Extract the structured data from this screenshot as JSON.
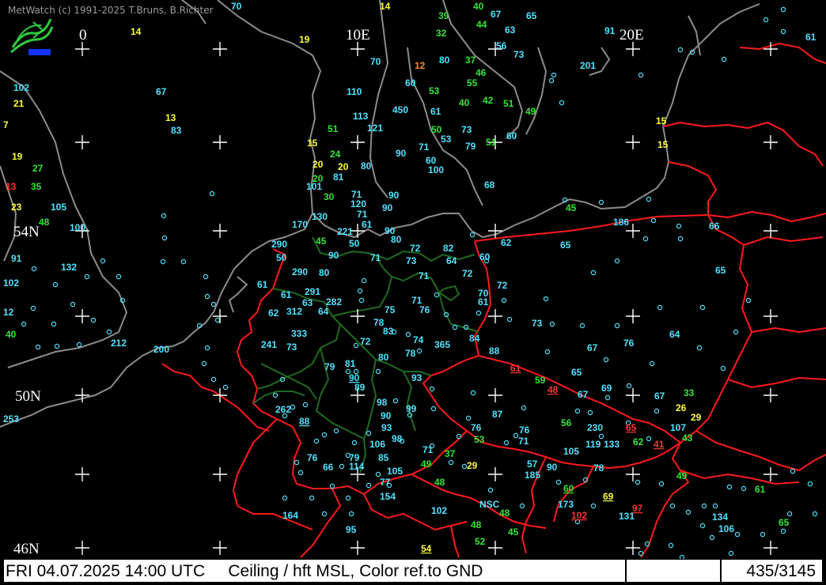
{
  "app": {
    "credit": "MetWatch  (c) 1991-2025 T.Bruns, B.Richter"
  },
  "status": {
    "datetime": "FRI 04.07.2025 14:00 UTC",
    "product": "Ceiling / hft MSL, Color ref.to GND",
    "count": "435/3145"
  },
  "colors": {
    "background": "#000000",
    "coast": "#8c8c8c",
    "border": "#ff1a1a",
    "germany_states": "#1f6a1f",
    "val_cyan": "#4fe3ff",
    "val_green": "#33e633",
    "val_yellow": "#ffff33",
    "val_orange": "#ff8c1a",
    "val_red": "#ff3333",
    "val_white": "#ffffff"
  },
  "grid_labels": {
    "lon_0": "0",
    "lon_10e": "10E",
    "lon_20e": "20E",
    "lat_54n": "54N",
    "lat_50n": "50N",
    "lat_46n": "46N"
  },
  "observations": [
    {
      "v": "70",
      "c": "cyan"
    },
    {
      "v": "14",
      "c": "yellow"
    },
    {
      "v": "39",
      "c": "green"
    },
    {
      "v": "40",
      "c": "green"
    },
    {
      "v": "67",
      "c": "cyan"
    },
    {
      "v": "65",
      "c": "cyan"
    },
    {
      "v": "14",
      "c": "yellow"
    },
    {
      "v": "19",
      "c": "yellow"
    },
    {
      "v": "32",
      "c": "green"
    },
    {
      "v": "44",
      "c": "green"
    },
    {
      "v": "63",
      "c": "cyan"
    },
    {
      "v": "91",
      "c": "cyan"
    },
    {
      "v": "61",
      "c": "cyan"
    },
    {
      "v": "70",
      "c": "cyan"
    },
    {
      "v": "12",
      "c": "orange"
    },
    {
      "v": "80",
      "c": "cyan"
    },
    {
      "v": "37",
      "c": "green"
    },
    {
      "v": "56",
      "c": "cyan"
    },
    {
      "v": "73",
      "c": "cyan"
    },
    {
      "v": "201",
      "c": "cyan"
    },
    {
      "v": "46",
      "c": "green"
    },
    {
      "v": "102",
      "c": "cyan"
    },
    {
      "v": "67",
      "c": "cyan"
    },
    {
      "v": "60",
      "c": "cyan"
    },
    {
      "v": "55",
      "c": "green"
    },
    {
      "v": "110",
      "c": "cyan"
    },
    {
      "v": "53",
      "c": "green"
    },
    {
      "v": "21",
      "c": "yellow"
    },
    {
      "v": "40",
      "c": "green"
    },
    {
      "v": "42",
      "c": "green"
    },
    {
      "v": "51",
      "c": "green"
    },
    {
      "v": "450",
      "c": "cyan"
    },
    {
      "v": "61",
      "c": "cyan"
    },
    {
      "v": "49",
      "c": "green"
    },
    {
      "v": "13",
      "c": "yellow"
    },
    {
      "v": "113",
      "c": "cyan"
    },
    {
      "v": "7",
      "c": "yellow"
    },
    {
      "v": "83",
      "c": "cyan"
    },
    {
      "v": "51",
      "c": "green"
    },
    {
      "v": "121",
      "c": "cyan"
    },
    {
      "v": "50",
      "c": "green"
    },
    {
      "v": "73",
      "c": "cyan"
    },
    {
      "v": "15",
      "c": "yellow"
    },
    {
      "v": "60",
      "c": "cyan"
    },
    {
      "v": "53",
      "c": "cyan"
    },
    {
      "v": "51",
      "c": "green"
    },
    {
      "v": "15",
      "c": "yellow"
    },
    {
      "v": "79",
      "c": "cyan"
    },
    {
      "v": "15",
      "c": "yellow"
    },
    {
      "v": "71",
      "c": "cyan"
    },
    {
      "v": "19",
      "c": "yellow"
    },
    {
      "v": "24",
      "c": "green"
    },
    {
      "v": "90",
      "c": "cyan"
    },
    {
      "v": "60",
      "c": "cyan"
    },
    {
      "v": "20",
      "c": "yellow"
    },
    {
      "v": "20",
      "c": "yellow"
    },
    {
      "v": "80",
      "c": "cyan"
    },
    {
      "v": "100",
      "c": "cyan"
    },
    {
      "v": "27",
      "c": "green"
    },
    {
      "v": "81",
      "c": "cyan"
    },
    {
      "v": "20",
      "c": "green"
    },
    {
      "v": "68",
      "c": "cyan"
    },
    {
      "v": "13",
      "c": "red"
    },
    {
      "v": "35",
      "c": "green"
    },
    {
      "v": "101",
      "c": "cyan"
    },
    {
      "v": "71",
      "c": "cyan"
    },
    {
      "v": "90",
      "c": "cyan"
    },
    {
      "v": "30",
      "c": "green"
    },
    {
      "v": "120",
      "c": "cyan"
    },
    {
      "v": "23",
      "c": "yellow"
    },
    {
      "v": "105",
      "c": "cyan"
    },
    {
      "v": "90",
      "c": "cyan"
    },
    {
      "v": "45",
      "c": "green"
    },
    {
      "v": "130",
      "c": "cyan"
    },
    {
      "v": "71",
      "c": "cyan"
    },
    {
      "v": "186",
      "c": "cyan"
    },
    {
      "v": "48",
      "c": "green"
    },
    {
      "v": "170",
      "c": "cyan"
    },
    {
      "v": "61",
      "c": "cyan"
    },
    {
      "v": "100",
      "c": "cyan"
    },
    {
      "v": "221",
      "c": "cyan"
    },
    {
      "v": "90",
      "c": "cyan"
    },
    {
      "v": "66",
      "c": "cyan"
    },
    {
      "v": "45",
      "c": "green"
    },
    {
      "v": "50",
      "c": "cyan"
    },
    {
      "v": "80",
      "c": "cyan"
    },
    {
      "v": "62",
      "c": "cyan"
    },
    {
      "v": "290",
      "c": "cyan"
    },
    {
      "v": "72",
      "c": "cyan"
    },
    {
      "v": "82",
      "c": "cyan"
    },
    {
      "v": "65",
      "c": "cyan"
    },
    {
      "v": "91",
      "c": "cyan"
    },
    {
      "v": "50",
      "c": "cyan"
    },
    {
      "v": "90",
      "c": "cyan"
    },
    {
      "v": "71",
      "c": "cyan"
    },
    {
      "v": "73",
      "c": "cyan"
    },
    {
      "v": "64",
      "c": "cyan"
    },
    {
      "v": "60",
      "c": "cyan"
    },
    {
      "v": "132",
      "c": "cyan"
    },
    {
      "v": "290",
      "c": "cyan"
    },
    {
      "v": "80",
      "c": "cyan"
    },
    {
      "v": "72",
      "c": "cyan"
    },
    {
      "v": "65",
      "c": "cyan"
    },
    {
      "v": "102",
      "c": "cyan"
    },
    {
      "v": "61",
      "c": "cyan"
    },
    {
      "v": "71",
      "c": "cyan"
    },
    {
      "v": "72",
      "c": "cyan"
    },
    {
      "v": "291",
      "c": "cyan"
    },
    {
      "v": "61",
      "c": "cyan"
    },
    {
      "v": "70",
      "c": "cyan"
    },
    {
      "v": "63",
      "c": "cyan"
    },
    {
      "v": "282",
      "c": "cyan"
    },
    {
      "v": "71",
      "c": "cyan"
    },
    {
      "v": "61",
      "c": "cyan"
    },
    {
      "v": "12",
      "c": "cyan"
    },
    {
      "v": "62",
      "c": "cyan"
    },
    {
      "v": "312",
      "c": "cyan"
    },
    {
      "v": "64",
      "c": "cyan"
    },
    {
      "v": "75",
      "c": "cyan"
    },
    {
      "v": "76",
      "c": "cyan"
    },
    {
      "v": "73",
      "c": "cyan"
    },
    {
      "v": "40",
      "c": "green"
    },
    {
      "v": "78",
      "c": "cyan"
    },
    {
      "v": "333",
      "c": "cyan"
    },
    {
      "v": "83",
      "c": "cyan"
    },
    {
      "v": "64",
      "c": "cyan"
    },
    {
      "v": "212",
      "c": "cyan"
    },
    {
      "v": "241",
      "c": "cyan"
    },
    {
      "v": "73",
      "c": "cyan"
    },
    {
      "v": "72",
      "c": "cyan"
    },
    {
      "v": "74",
      "c": "cyan"
    },
    {
      "v": "84",
      "c": "cyan"
    },
    {
      "v": "76",
      "c": "cyan"
    },
    {
      "v": "200",
      "c": "cyan"
    },
    {
      "v": "365",
      "c": "cyan"
    },
    {
      "v": "67",
      "c": "cyan"
    },
    {
      "v": "88",
      "c": "cyan"
    },
    {
      "v": "78",
      "c": "cyan"
    },
    {
      "v": "80",
      "c": "cyan"
    },
    {
      "v": "79",
      "c": "cyan"
    },
    {
      "v": "81",
      "c": "cyan"
    },
    {
      "v": "61",
      "c": "red",
      "u": true
    },
    {
      "v": "65",
      "c": "cyan"
    },
    {
      "v": "90",
      "c": "cyan",
      "u": true
    },
    {
      "v": "93",
      "c": "cyan"
    },
    {
      "v": "59",
      "c": "green"
    },
    {
      "v": "89",
      "c": "cyan"
    },
    {
      "v": "48",
      "c": "red",
      "u": true
    },
    {
      "v": "69",
      "c": "cyan"
    },
    {
      "v": "67",
      "c": "cyan"
    },
    {
      "v": "67",
      "c": "cyan"
    },
    {
      "v": "33",
      "c": "green"
    },
    {
      "v": "253",
      "c": "cyan"
    },
    {
      "v": "98",
      "c": "cyan"
    },
    {
      "v": "262",
      "c": "cyan"
    },
    {
      "v": "99",
      "c": "cyan"
    },
    {
      "v": "87",
      "c": "cyan"
    },
    {
      "v": "26",
      "c": "yellow"
    },
    {
      "v": "90",
      "c": "cyan"
    },
    {
      "v": "29",
      "c": "yellow"
    },
    {
      "v": "88",
      "c": "cyan",
      "u": true
    },
    {
      "v": "76",
      "c": "cyan"
    },
    {
      "v": "56",
      "c": "green"
    },
    {
      "v": "230",
      "c": "cyan"
    },
    {
      "v": "65",
      "c": "red",
      "u": true
    },
    {
      "v": "107",
      "c": "cyan"
    },
    {
      "v": "93",
      "c": "cyan"
    },
    {
      "v": "76",
      "c": "cyan"
    },
    {
      "v": "53",
      "c": "green"
    },
    {
      "v": "98",
      "c": "cyan"
    },
    {
      "v": "71",
      "c": "cyan"
    },
    {
      "v": "62",
      "c": "green"
    },
    {
      "v": "43",
      "c": "green"
    },
    {
      "v": "106",
      "c": "cyan"
    },
    {
      "v": "119",
      "c": "cyan"
    },
    {
      "v": "41",
      "c": "red",
      "u": true
    },
    {
      "v": "71",
      "c": "cyan"
    },
    {
      "v": "133",
      "c": "cyan"
    },
    {
      "v": "37",
      "c": "green"
    },
    {
      "v": "105",
      "c": "cyan"
    },
    {
      "v": "76",
      "c": "cyan"
    },
    {
      "v": "79",
      "c": "cyan"
    },
    {
      "v": "85",
      "c": "cyan"
    },
    {
      "v": "49",
      "c": "green"
    },
    {
      "v": "29",
      "c": "yellow"
    },
    {
      "v": "57",
      "c": "cyan"
    },
    {
      "v": "90",
      "c": "cyan"
    },
    {
      "v": "78",
      "c": "cyan"
    },
    {
      "v": "49",
      "c": "green"
    },
    {
      "v": "66",
      "c": "cyan"
    },
    {
      "v": "114",
      "c": "cyan"
    },
    {
      "v": "105",
      "c": "cyan"
    },
    {
      "v": "185",
      "c": "cyan"
    },
    {
      "v": "77",
      "c": "cyan"
    },
    {
      "v": "48",
      "c": "green"
    },
    {
      "v": "60",
      "c": "green",
      "u": true
    },
    {
      "v": "61",
      "c": "green"
    },
    {
      "v": "154",
      "c": "cyan"
    },
    {
      "v": "69",
      "c": "yellow",
      "u": true
    },
    {
      "v": "97",
      "c": "red",
      "u": true
    },
    {
      "v": "NSC",
      "c": "cyan"
    },
    {
      "v": "173",
      "c": "cyan"
    },
    {
      "v": "102",
      "c": "cyan"
    },
    {
      "v": "48",
      "c": "green"
    },
    {
      "v": "102",
      "c": "red",
      "u": true
    },
    {
      "v": "131",
      "c": "cyan"
    },
    {
      "v": "134",
      "c": "cyan"
    },
    {
      "v": "164",
      "c": "cyan"
    },
    {
      "v": "48",
      "c": "green"
    },
    {
      "v": "65",
      "c": "green"
    },
    {
      "v": "95",
      "c": "cyan"
    },
    {
      "v": "45",
      "c": "green"
    },
    {
      "v": "106",
      "c": "cyan"
    },
    {
      "v": "52",
      "c": "green"
    },
    {
      "v": "54",
      "c": "yellow",
      "u": true
    },
    {
      "v": "72",
      "c": "cyan"
    },
    {
      "v": "114",
      "c": "cyan"
    }
  ]
}
